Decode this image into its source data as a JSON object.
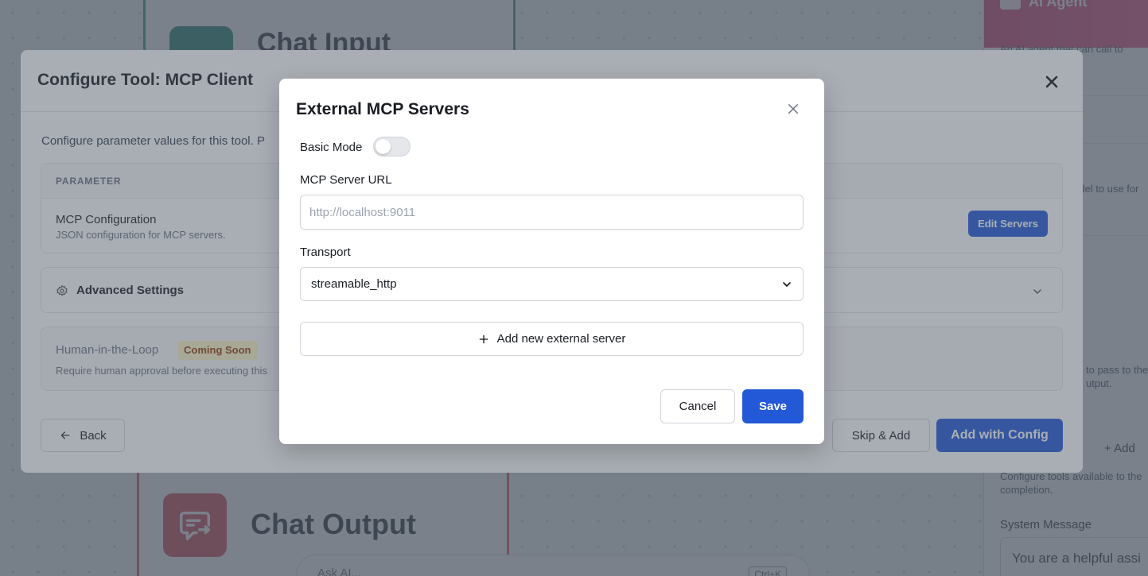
{
  "canvas": {
    "top_node_title": "Chat Input",
    "bottom_node_title": "Chat Output",
    "ask_ai": {
      "label": "Ask AI...",
      "shortcut": "Ctrl+K"
    }
  },
  "right_panel": {
    "title": "AI Agent",
    "description": "An AI agent that can call to",
    "model_hint": "odel to use for",
    "pass_hint_1": "to pass to the",
    "pass_hint_2": "utput.",
    "add_label": "Add",
    "tools_hint_1": "Configure tools available to the",
    "tools_hint_2": "completion.",
    "system_message_label": "System Message",
    "system_message_value": "You are a helpful assi"
  },
  "configure_modal": {
    "title": "Configure Tool: MCP Client",
    "description": "Configure parameter values for this tool. P",
    "table_header": "PARAMETER",
    "param_name": "MCP Configuration",
    "param_desc": "JSON configuration for MCP servers.",
    "edit_button": "Edit Servers",
    "advanced_label": "Advanced Settings",
    "hitl_label": "Human-in-the-Loop",
    "hitl_badge": "Coming Soon",
    "hitl_desc": "Require human approval before executing this",
    "back_button": "Back",
    "skip_button": "Skip & Add",
    "add_button": "Add with Config"
  },
  "external_modal": {
    "title": "External MCP Servers",
    "basic_mode_label": "Basic Mode",
    "basic_mode_on": false,
    "url_label": "MCP Server URL",
    "url_value": "",
    "url_placeholder": "http://localhost:9011",
    "transport_label": "Transport",
    "transport_value": "streamable_http",
    "add_server_label": "Add new external server",
    "cancel_label": "Cancel",
    "save_label": "Save"
  },
  "colors": {
    "primary": "#2358d6",
    "chat_input_node": "#107c6b",
    "chat_output_node": "#d63a4b",
    "agent_header": "#d6336c",
    "badge_bg": "#fef3c7"
  }
}
